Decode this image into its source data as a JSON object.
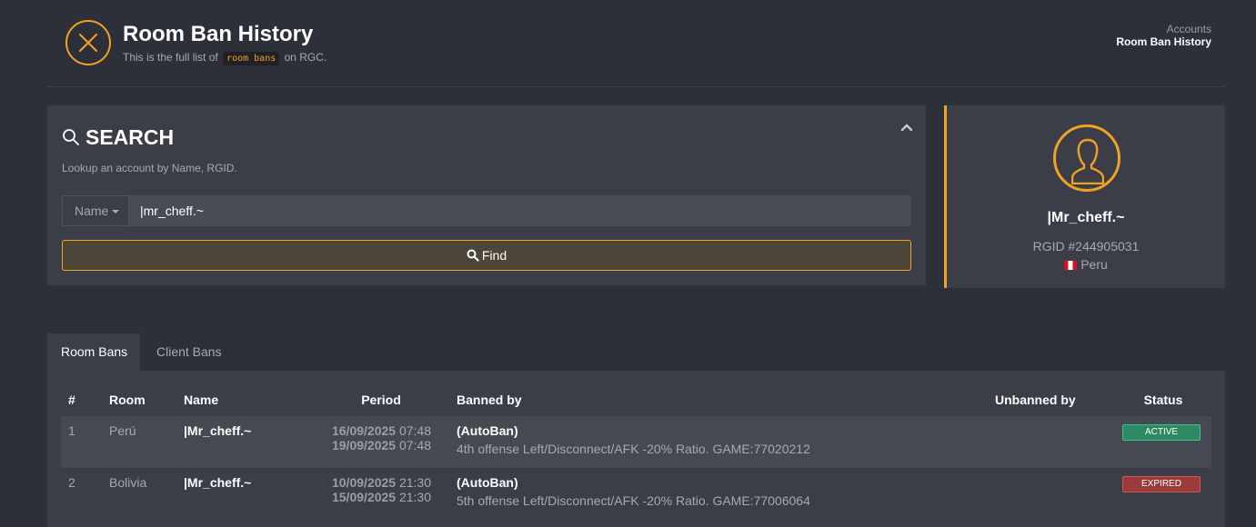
{
  "header": {
    "title": "Room Ban History",
    "subtitle_prefix": "This is the full list of",
    "subtitle_code": "room bans",
    "subtitle_suffix": "on RGC."
  },
  "breadcrumb": {
    "items": [
      "Accounts",
      "Room Ban History"
    ]
  },
  "search": {
    "title": "SEARCH",
    "help": "Lookup an account by Name, RGID.",
    "select_value": "Name",
    "input_value": "|mr_cheff.~",
    "find_label": "Find"
  },
  "profile": {
    "name": "|Mr_cheff.~",
    "rgid": "RGID #244905031",
    "country": "Peru"
  },
  "tabs": [
    {
      "label": "Room Bans"
    },
    {
      "label": "Client Bans"
    }
  ],
  "table": {
    "headers": [
      "#",
      "Room",
      "Name",
      "Period",
      "Banned by",
      "Unbanned by",
      "Status"
    ],
    "rows": [
      {
        "num": "1",
        "room": "Perú",
        "name": "|Mr_cheff.~",
        "start_date": "16/09/2025",
        "start_time": "07:48",
        "end_date": "19/09/2025",
        "end_time": "07:48",
        "banned_by": "(AutoBan)",
        "reason": "4th offense Left/Disconnect/AFK -20% Ratio. GAME:77020212",
        "unbanned_by": "",
        "status": "ACTIVE"
      },
      {
        "num": "2",
        "room": "Bolivia",
        "name": "|Mr_cheff.~",
        "start_date": "10/09/2025",
        "start_time": "21:30",
        "end_date": "15/09/2025",
        "end_time": "21:30",
        "banned_by": "(AutoBan)",
        "reason": "5th offense Left/Disconnect/AFK -20% Ratio. GAME:77006064",
        "unbanned_by": "",
        "status": "EXPIRED"
      }
    ]
  },
  "colors": {
    "accent": "#f0a224",
    "active": "#2d8a63",
    "expired": "#9a3b3b"
  }
}
